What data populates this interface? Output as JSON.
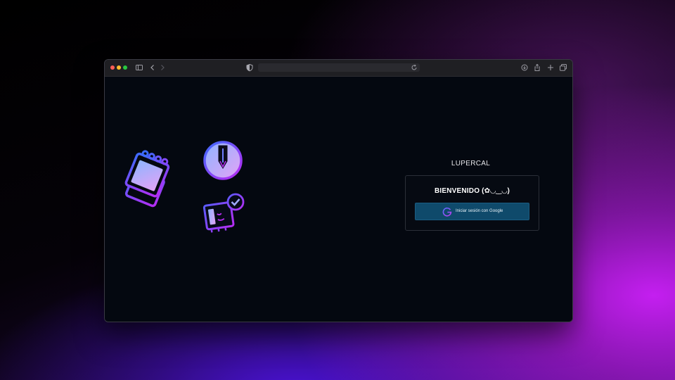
{
  "browser": {
    "url": "",
    "window_controls": [
      "close",
      "minimize",
      "zoom"
    ],
    "toolbar_icons": [
      "sidebar-icon",
      "back-icon",
      "forward-icon",
      "shield-icon",
      "reload-icon",
      "download-icon",
      "share-icon",
      "new-tab-icon",
      "tabs-icon"
    ]
  },
  "app": {
    "title": "LUPERCAL",
    "welcome": "BIENVENIDO (✿◡‿◡)",
    "google_button_label": "Iniciar sesión con Google"
  },
  "colors": {
    "accent_blue": "#2b5cff",
    "accent_purple": "#b52ff0",
    "button_bg": "#0f4a6b",
    "page_bg": "#040810"
  },
  "illustrations": [
    "notepad-icon",
    "pencil-badge-icon",
    "checked-card-icon"
  ]
}
